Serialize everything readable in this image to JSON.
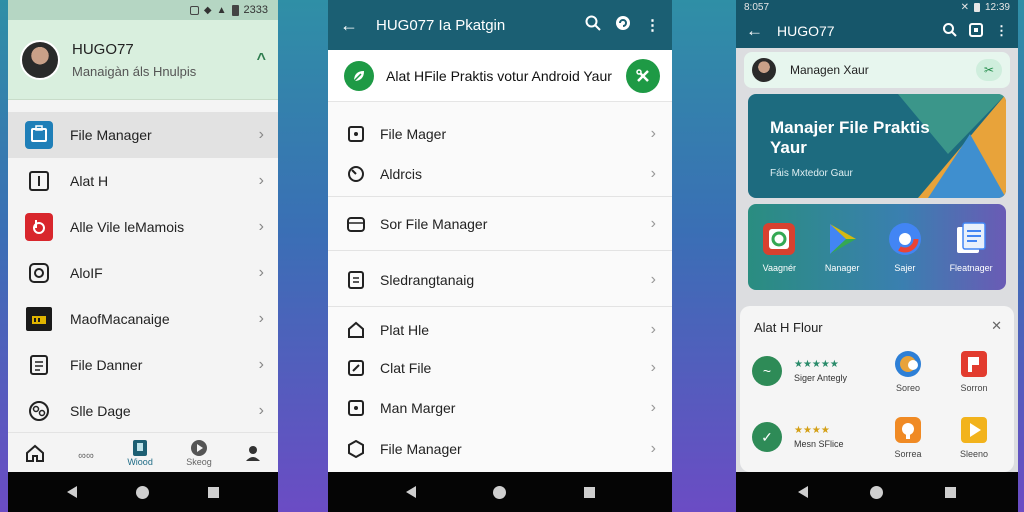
{
  "phone1": {
    "status_time": "2333",
    "profile_name": "HUGO77",
    "profile_subtitle": "Manaigàn áls Hnulpis",
    "menu": [
      {
        "label": "File Manager",
        "icon": "briefcase-icon"
      },
      {
        "label": "Alat H",
        "icon": "square-box-icon"
      },
      {
        "label": "Alle Vile leMamois",
        "icon": "red-app-icon"
      },
      {
        "label": "AloIF",
        "icon": "rounded-square-icon"
      },
      {
        "label": "MaofMacanaige",
        "icon": "black-app-icon"
      },
      {
        "label": "File Danner",
        "icon": "document-icon"
      },
      {
        "label": "Slle Dage",
        "icon": "circle-scatter-icon"
      }
    ],
    "bottom_tabs": [
      {
        "label": "",
        "icon": "home-icon"
      },
      {
        "label": "∞∞",
        "icon": "infinity-icon"
      },
      {
        "label": "Wiood",
        "icon": "folder-icon"
      },
      {
        "label": "Skeog",
        "icon": "compass-icon"
      },
      {
        "label": "",
        "icon": "person-icon"
      }
    ]
  },
  "phone2": {
    "title": "HUG077 Ia Pkatgin",
    "hero_text": "Alat HFile Praktis votur Android Yaur",
    "rows": [
      {
        "label": "File Mager",
        "icon": "square-dot-icon"
      },
      {
        "label": "Aldrcis",
        "icon": "circle-outline-icon"
      },
      {
        "label": "Sor File Manager",
        "icon": "folder-outline-icon"
      },
      {
        "label": "Sledrangtanaig",
        "icon": "list-icon"
      },
      {
        "label": "Plat Hle",
        "icon": "home-outline-icon"
      },
      {
        "label": "Clat File",
        "icon": "edit-icon"
      },
      {
        "label": "Man Marger",
        "icon": "square-dot-icon"
      },
      {
        "label": "File Manager",
        "icon": "hexagon-icon"
      }
    ]
  },
  "phone3": {
    "status_left": "8:057",
    "status_right": "12:39",
    "title": "HUGO77",
    "profile_label": "Managen Xaur",
    "banner_title": "Manajer File Praktis Yaur",
    "banner_subtitle": "Fáis Mxtedor Gaur",
    "apps": [
      {
        "label": "Vaagnér",
        "icon": "maps-icon"
      },
      {
        "label": "Nanager",
        "icon": "play-icon"
      },
      {
        "label": "Sajer",
        "icon": "chrome-icon"
      },
      {
        "label": "Fleatnager",
        "icon": "docs-icon"
      }
    ],
    "card_title": "Alat H Flour",
    "card_rows": [
      {
        "stars": "★★★★★",
        "text": "Siger Antegly",
        "apps": [
          {
            "label": "Soreo"
          },
          {
            "label": "Sorron"
          }
        ]
      },
      {
        "stars": "★★★★",
        "text": "Mesn SFlice",
        "apps": [
          {
            "label": "Sorrea"
          },
          {
            "label": "Sleeno"
          }
        ]
      }
    ]
  }
}
